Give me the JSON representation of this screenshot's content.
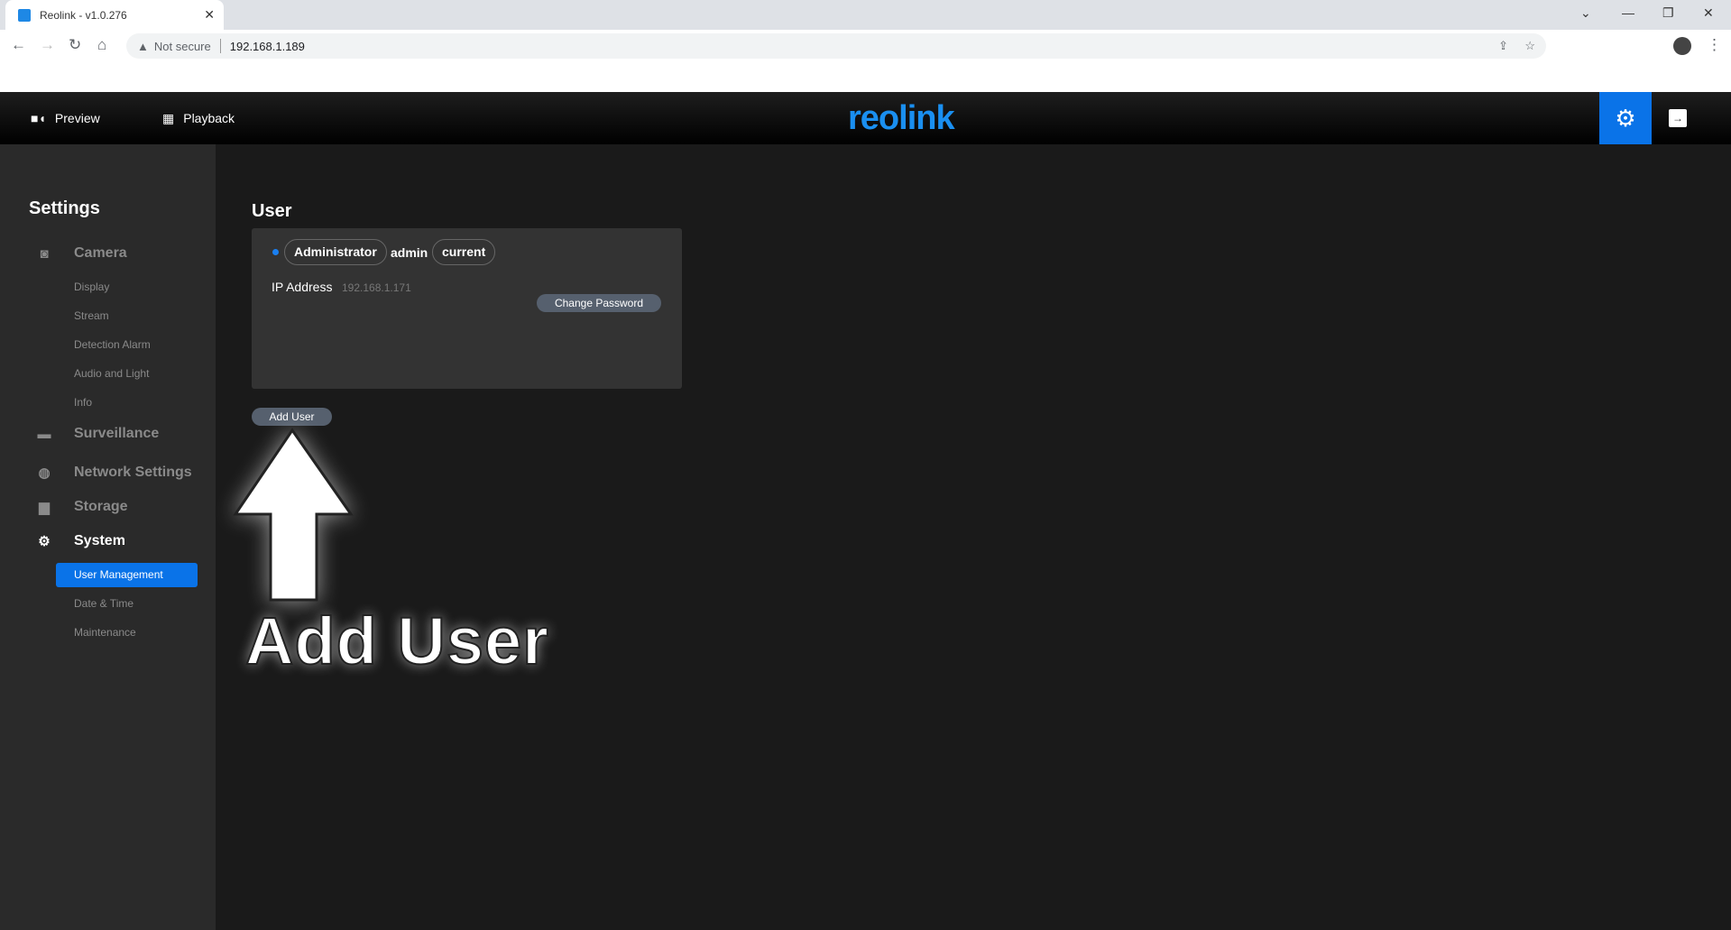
{
  "browser": {
    "tab_title": "Reolink - v1.0.276",
    "security": "Not secure",
    "url": "192.168.1.189"
  },
  "header": {
    "preview": "Preview",
    "playback": "Playback",
    "logo": "reolink",
    "accent": "#0a73e8"
  },
  "sidebar": {
    "title": "Settings",
    "groups": [
      {
        "label": "Camera",
        "icon": "camera-icon",
        "items": [
          "Display",
          "Stream",
          "Detection Alarm",
          "Audio and Light",
          "Info"
        ]
      },
      {
        "label": "Surveillance",
        "icon": "monitor-icon"
      },
      {
        "label": "Network Settings",
        "icon": "globe-icon"
      },
      {
        "label": "Storage",
        "icon": "storage-icon"
      },
      {
        "label": "System",
        "icon": "gear-icon",
        "items": [
          "User Management",
          "Date & Time",
          "Maintenance"
        ],
        "active_item": "User Management"
      }
    ]
  },
  "main": {
    "title": "User",
    "user": {
      "role": "Administrator",
      "name": "admin",
      "status": "current",
      "ip_label": "IP Address",
      "ip": "192.168.1.171",
      "change_password": "Change Password"
    },
    "add_user": "Add User"
  },
  "annotation": {
    "text": "Add User"
  }
}
